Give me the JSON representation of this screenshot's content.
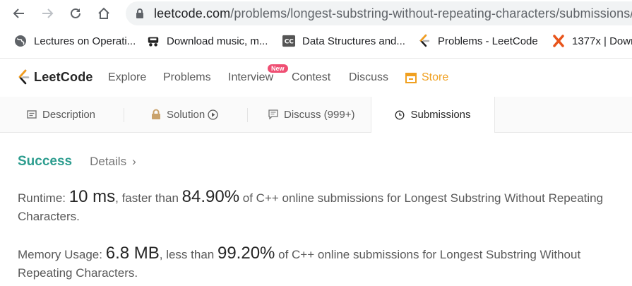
{
  "browser": {
    "url_host": "leetcode.com",
    "url_path": "/problems/longest-substring-without-repeating-characters/submissions/",
    "bookmarks": [
      {
        "label": "Lectures on Operati...",
        "icon": "globe-icon"
      },
      {
        "label": "Download music, m...",
        "icon": "mp3-icon"
      },
      {
        "label": "Data Structures and...",
        "icon": "cc-icon"
      },
      {
        "label": "Problems - LeetCode",
        "icon": "leetcode-icon"
      },
      {
        "label": "1377x | Dowr",
        "icon": "x-icon"
      }
    ]
  },
  "nav": {
    "logo": "LeetCode",
    "links": [
      "Explore",
      "Problems",
      "Interview",
      "Contest",
      "Discuss"
    ],
    "badge": "New",
    "store": "Store"
  },
  "tabs": [
    {
      "label": "Description",
      "icon": "doc-icon"
    },
    {
      "label": "Solution",
      "icon": "lock-icon"
    },
    {
      "label": "Discuss (999+)",
      "icon": "comment-icon"
    },
    {
      "label": "Submissions",
      "icon": "clock-icon"
    }
  ],
  "result": {
    "status": "Success",
    "details": "Details",
    "runtime_label": "Runtime:",
    "runtime_value": "10 ms",
    "runtime_mid": ", faster than",
    "runtime_pct": "84.90%",
    "runtime_tail": "of C++ online submissions for Longest Substring Without Repeating",
    "runtime_tail2": "Characters.",
    "memory_label": "Memory Usage:",
    "memory_value": "6.8 MB",
    "memory_mid": ", less than",
    "memory_pct": "99.20%",
    "memory_tail": "of C++ online submissions for Longest Substring Without",
    "memory_tail2": "Repeating Characters."
  },
  "colors": {
    "success": "#2d9d8f",
    "store": "#f0a020",
    "badge": "#ef4f73"
  }
}
